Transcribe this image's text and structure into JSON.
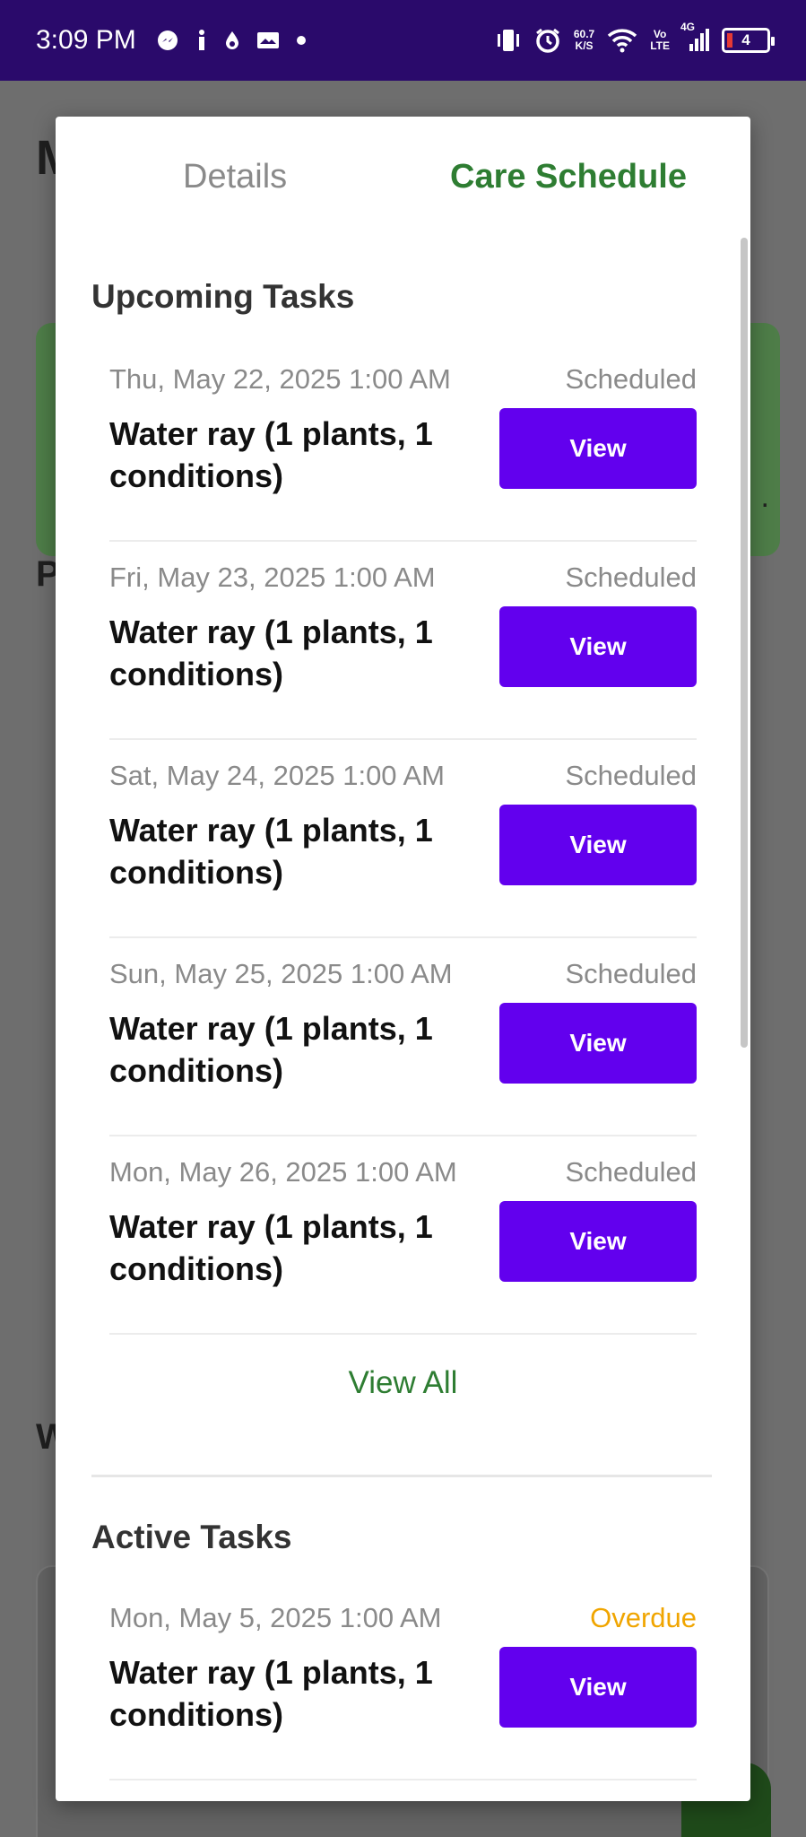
{
  "status_bar": {
    "time": "3:09 PM",
    "net_speed_value": "60.7",
    "net_speed_unit": "K/S",
    "volte_top": "Vo",
    "volte_bottom": "LTE",
    "network_type": "4G",
    "battery_level": "4",
    "icons": [
      "messenger-icon",
      "info-icon",
      "drop-icon",
      "gallery-icon",
      "dot-icon",
      "vibrate-icon",
      "alarm-icon",
      "wifi-icon",
      "signal-icon",
      "battery-icon"
    ]
  },
  "tabs": {
    "details": "Details",
    "care_schedule": "Care Schedule",
    "active_color": "#2e7d32"
  },
  "upcoming": {
    "title": "Upcoming Tasks",
    "tasks": [
      {
        "date": "Thu, May 22, 2025 1:00 AM",
        "status": "Scheduled",
        "title": "Water ray (1 plants, 1 conditions)",
        "button": "View"
      },
      {
        "date": "Fri, May 23, 2025 1:00 AM",
        "status": "Scheduled",
        "title": "Water ray (1 plants, 1 conditions)",
        "button": "View"
      },
      {
        "date": "Sat, May 24, 2025 1:00 AM",
        "status": "Scheduled",
        "title": "Water ray (1 plants, 1 conditions)",
        "button": "View"
      },
      {
        "date": "Sun, May 25, 2025 1:00 AM",
        "status": "Scheduled",
        "title": "Water ray (1 plants, 1 conditions)",
        "button": "View"
      },
      {
        "date": "Mon, May 26, 2025 1:00 AM",
        "status": "Scheduled",
        "title": "Water ray (1 plants, 1 conditions)",
        "button": "View"
      }
    ],
    "view_all": "View All"
  },
  "active": {
    "title": "Active Tasks",
    "tasks": [
      {
        "date": "Mon, May 5, 2025 1:00 AM",
        "status": "Overdue",
        "title": "Water ray (1 plants, 1 conditions)",
        "button": "View"
      }
    ]
  },
  "background": {
    "heading_initial_1": "M",
    "heading_initial_2": "P",
    "heading_initial_3": "W",
    "card_dot": "."
  },
  "colors": {
    "primary_button": "#6200ee",
    "status_bar": "#2a0a6b",
    "overdue": "#f0a500"
  }
}
